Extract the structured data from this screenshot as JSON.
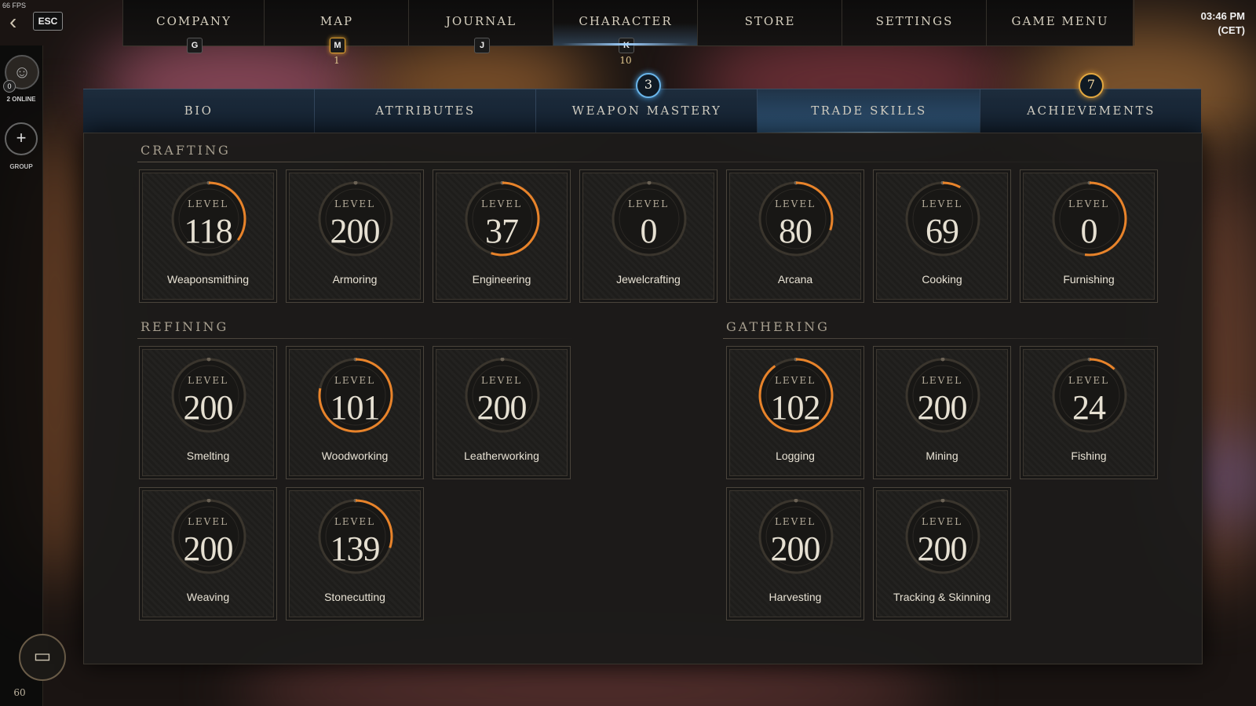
{
  "hud": {
    "fps": "66 FPS",
    "esc_label": "ESC",
    "clock_time": "03:46 PM",
    "clock_zone": "(CET)"
  },
  "nav": [
    {
      "label": "COMPANY",
      "key": "G",
      "count": ""
    },
    {
      "label": "MAP",
      "key": "M",
      "count": "1"
    },
    {
      "label": "JOURNAL",
      "key": "J",
      "count": ""
    },
    {
      "label": "CHARACTER",
      "key": "K",
      "count": "10"
    },
    {
      "label": "STORE",
      "key": "",
      "count": ""
    },
    {
      "label": "SETTINGS",
      "key": "",
      "count": ""
    },
    {
      "label": "GAME MENU",
      "key": "",
      "count": ""
    }
  ],
  "rail": {
    "online_count": "0",
    "online_label": "2 ONLINE",
    "group_label": "GROUP",
    "player_level": "60"
  },
  "tabs": [
    {
      "label": "BIO",
      "badge": ""
    },
    {
      "label": "ATTRIBUTES",
      "badge": ""
    },
    {
      "label": "WEAPON MASTERY",
      "badge": "3"
    },
    {
      "label": "TRADE SKILLS",
      "badge": ""
    },
    {
      "label": "ACHIEVEMENTS",
      "badge": "7"
    }
  ],
  "level_word": "LEVEL",
  "sections": {
    "crafting": {
      "title": "CRAFTING",
      "skills": [
        {
          "name": "Weaponsmithing",
          "level": "118",
          "progress": 0.35
        },
        {
          "name": "Armoring",
          "level": "200",
          "progress": 0
        },
        {
          "name": "Engineering",
          "level": "37",
          "progress": 0.55
        },
        {
          "name": "Jewelcrafting",
          "level": "0",
          "progress": 0
        },
        {
          "name": "Arcana",
          "level": "80",
          "progress": 0.3
        },
        {
          "name": "Cooking",
          "level": "69",
          "progress": 0.08
        },
        {
          "name": "Furnishing",
          "level": "0",
          "progress": 0.52
        }
      ]
    },
    "refining": {
      "title": "REFINING",
      "skills": [
        {
          "name": "Smelting",
          "level": "200",
          "progress": 0
        },
        {
          "name": "Woodworking",
          "level": "101",
          "progress": 0.78
        },
        {
          "name": "Leatherworking",
          "level": "200",
          "progress": 0
        },
        {
          "name": "Weaving",
          "level": "200",
          "progress": 0
        },
        {
          "name": "Stonecutting",
          "level": "139",
          "progress": 0.3
        }
      ]
    },
    "gathering": {
      "title": "GATHERING",
      "skills": [
        {
          "name": "Logging",
          "level": "102",
          "progress": 0.9
        },
        {
          "name": "Mining",
          "level": "200",
          "progress": 0
        },
        {
          "name": "Fishing",
          "level": "24",
          "progress": 0.12
        },
        {
          "name": "Harvesting",
          "level": "200",
          "progress": 0
        },
        {
          "name": "Tracking & Skinning",
          "level": "200",
          "progress": 0
        }
      ]
    }
  },
  "colors": {
    "progress_arc": "#e8832a",
    "ring": "#3a352d",
    "tab_active": "#4f8fc4"
  },
  "icons": {
    "back": "back-arrow-icon",
    "avatar": "friends-icon",
    "group": "plus-icon",
    "chat": "chat-icon"
  }
}
